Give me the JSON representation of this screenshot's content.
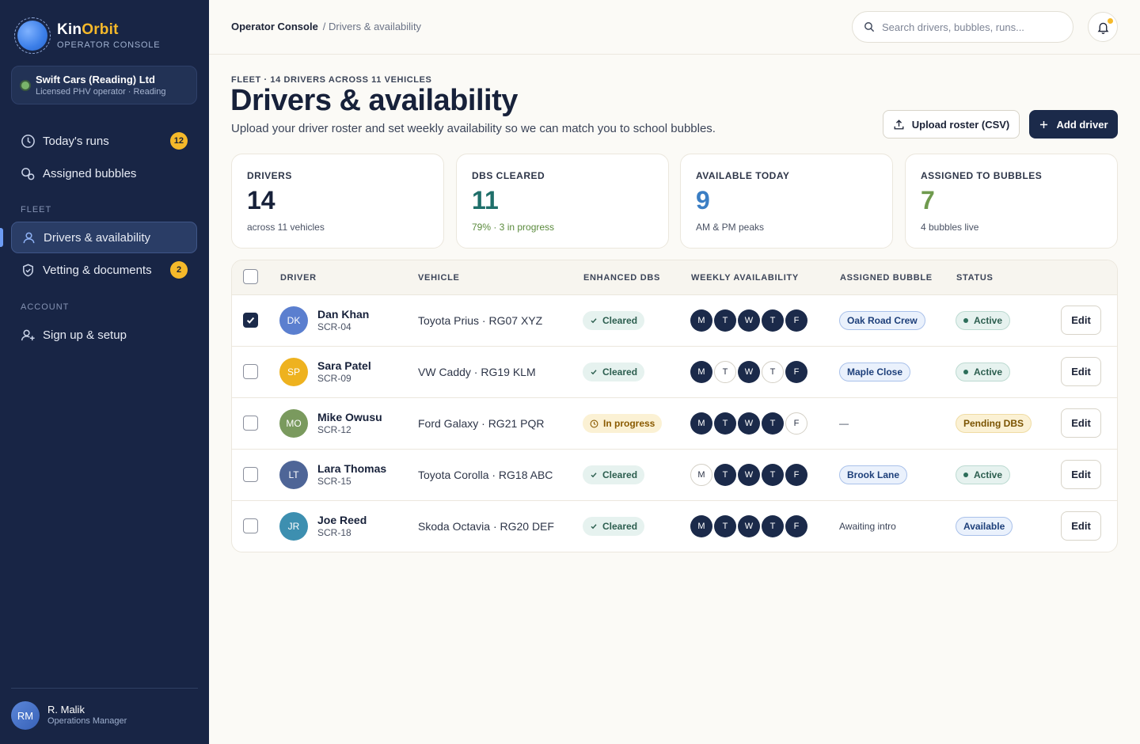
{
  "brand": {
    "name_part1": "Kin",
    "name_part2": "Orbit",
    "subtitle": "OPERATOR CONSOLE"
  },
  "org": {
    "name": "Swift Cars (Reading) Ltd",
    "sub": "Licensed PHV operator · Reading",
    "status_color": "#79b36a"
  },
  "nav": {
    "todays_runs": {
      "label": "Today's runs",
      "badge": "12",
      "icon": "clock-icon"
    },
    "assigned_bubbles": {
      "label": "Assigned bubbles",
      "icon": "bubbles-icon"
    },
    "fleet_section": "FLEET",
    "drivers": {
      "label": "Drivers & availability",
      "icon": "user-icon"
    },
    "vetting": {
      "label": "Vetting & documents",
      "badge": "2",
      "icon": "shield-icon"
    },
    "account_section": "ACCOUNT",
    "signup": {
      "label": "Sign up & setup",
      "icon": "user-plus-icon"
    }
  },
  "user": {
    "initials": "RM",
    "name": "R. Malik",
    "role": "Operations Manager"
  },
  "topbar": {
    "crumb_root": "Operator Console",
    "crumb_current": "/ Drivers & availability",
    "search_placeholder": "Search drivers, bubbles, runs..."
  },
  "header": {
    "eyebrow": "FLEET · 14 DRIVERS ACROSS 11 VEHICLES",
    "title": "Drivers & availability",
    "subtitle": "Upload your driver roster and set weekly availability so we can match you to school bubbles.",
    "upload_label": "Upload roster (CSV)",
    "add_label": "Add driver"
  },
  "stats": [
    {
      "label": "DRIVERS",
      "value": "14",
      "note": "across 11 vehicles",
      "color": "#17213a",
      "note_color": "#4a5264"
    },
    {
      "label": "DBS CLEARED",
      "value": "11",
      "note": "79% · 3 in progress",
      "color": "#1f6f6a",
      "note_color": "#5a8a3c"
    },
    {
      "label": "AVAILABLE TODAY",
      "value": "9",
      "note": "AM & PM peaks",
      "color": "#3b7ec4",
      "note_color": "#4a5264"
    },
    {
      "label": "ASSIGNED TO BUBBLES",
      "value": "7",
      "note": "4 bubbles live",
      "color": "#6f9a4e",
      "note_color": "#4a5264"
    }
  ],
  "table": {
    "columns": [
      "DRIVER",
      "VEHICLE",
      "ENHANCED DBS",
      "WEEKLY AVAILABILITY",
      "ASSIGNED BUBBLE",
      "STATUS"
    ],
    "edit_label": "Edit",
    "rows": [
      {
        "checked": true,
        "initials": "DK",
        "avatar_color": "#5b7fcf",
        "name": "Dan Khan",
        "id": "SCR-04",
        "vehicle": "Toyota Prius · RG07 XYZ",
        "dbs": "Cleared",
        "dbs_kind": "ok",
        "days": [
          "M",
          "T",
          "W",
          "T",
          "F"
        ],
        "days_on": [
          true,
          true,
          true,
          true,
          true
        ],
        "bubble": "Oak Road Crew",
        "status": "Active",
        "status_kind": "active"
      },
      {
        "checked": false,
        "initials": "SP",
        "avatar_color": "#eeb21f",
        "name": "Sara Patel",
        "id": "SCR-09",
        "vehicle": "VW Caddy · RG19 KLM",
        "dbs": "Cleared",
        "dbs_kind": "ok",
        "days": [
          "M",
          "T",
          "W",
          "T",
          "F"
        ],
        "days_on": [
          true,
          false,
          true,
          false,
          true
        ],
        "bubble": "Maple Close",
        "status": "Active",
        "status_kind": "active"
      },
      {
        "checked": false,
        "initials": "MO",
        "avatar_color": "#7a9a5e",
        "name": "Mike Owusu",
        "id": "SCR-12",
        "vehicle": "Ford Galaxy · RG21 PQR",
        "dbs": "In progress",
        "dbs_kind": "prog",
        "days": [
          "M",
          "T",
          "W",
          "T",
          "F"
        ],
        "days_on": [
          true,
          true,
          true,
          true,
          false
        ],
        "bubble": "—",
        "status": "Pending DBS",
        "status_kind": "pending"
      },
      {
        "checked": false,
        "initials": "LT",
        "avatar_color": "#4e6597",
        "name": "Lara Thomas",
        "id": "SCR-15",
        "vehicle": "Toyota Corolla · RG18 ABC",
        "dbs": "Cleared",
        "dbs_kind": "ok",
        "days": [
          "M",
          "T",
          "W",
          "T",
          "F"
        ],
        "days_on": [
          false,
          true,
          true,
          true,
          true
        ],
        "bubble": "Brook Lane",
        "status": "Active",
        "status_kind": "active"
      },
      {
        "checked": false,
        "initials": "JR",
        "avatar_color": "#3d8fb0",
        "name": "Joe Reed",
        "id": "SCR-18",
        "vehicle": "Skoda Octavia · RG20 DEF",
        "dbs": "Cleared",
        "dbs_kind": "ok",
        "days": [
          "M",
          "T",
          "W",
          "T",
          "F"
        ],
        "days_on": [
          true,
          true,
          true,
          true,
          true
        ],
        "bubble": "Awaiting intro",
        "status": "Available",
        "status_kind": "available"
      }
    ]
  }
}
